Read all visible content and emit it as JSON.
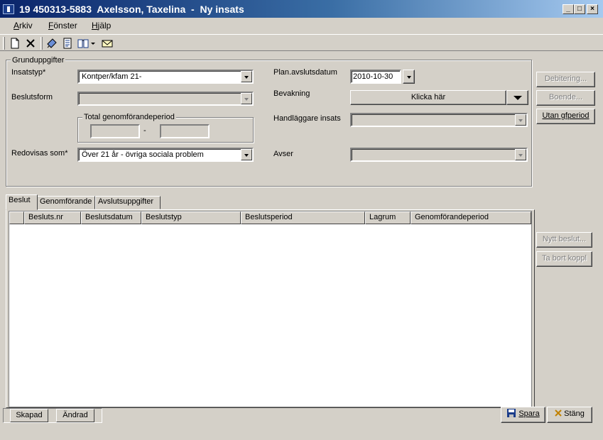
{
  "window": {
    "title": "19 450313-5883  Axelsson, Taxelina  -  Ny insats",
    "controls": {
      "minimize": "_",
      "maximize": "□",
      "close": "×"
    }
  },
  "menu": {
    "items": [
      {
        "label": "Arkiv",
        "accel": "A",
        "rest": "rkiv"
      },
      {
        "label": "Fönster",
        "accel": "F",
        "rest": "önster"
      },
      {
        "label": "Hjälp",
        "accel": "H",
        "rest": "jälp"
      }
    ]
  },
  "toolbar": {
    "icons": [
      "new-document-icon",
      "delete-icon",
      "edit-icon",
      "report-icon",
      "book-icon",
      "dropdown-arrow-icon",
      "mail-icon"
    ]
  },
  "grundupp": {
    "legend": "Grunduppgifter",
    "insatstyp": {
      "label": "Insatstyp*",
      "value": "Kontper/kfam 21-"
    },
    "beslutsform": {
      "label": "Beslutsform",
      "value": ""
    },
    "total": {
      "legend": "Total genomförandeperiod",
      "separator": "-"
    },
    "redovisas": {
      "label": "Redovisas som*",
      "value": "Över 21 år - övriga sociala problem"
    },
    "plan": {
      "label": "Plan.avslutsdatum",
      "value": "2010-10-30"
    },
    "bevakning": {
      "label": "Bevakning",
      "button": "Klicka här"
    },
    "handlaggare": {
      "label": "Handläggare insats",
      "value": ""
    },
    "avser": {
      "label": "Avser",
      "value": ""
    }
  },
  "side_buttons": {
    "debitering": "Debitering...",
    "boende": "Boende...",
    "utan": "Utan gfperiod",
    "nytt": "Nytt beslut...",
    "tabort": "Ta bort koppl"
  },
  "tabs": [
    "Beslut",
    "Genomförande",
    "Avslutsuppgifter"
  ],
  "grid": {
    "columns": [
      "Besluts.nr",
      "Beslutsdatum",
      "Beslutstyp",
      "Beslutsperiod",
      "Lagrum",
      "Genomförandeperiod"
    ]
  },
  "status": {
    "skapad": "Skapad",
    "andrad": "Ändrad"
  },
  "footer": {
    "spara": "Spara",
    "stang": "Stäng"
  },
  "colors": {
    "titlebar_start": "#0a246a",
    "titlebar_end": "#a6caf0",
    "face": "#d4d0c8"
  }
}
